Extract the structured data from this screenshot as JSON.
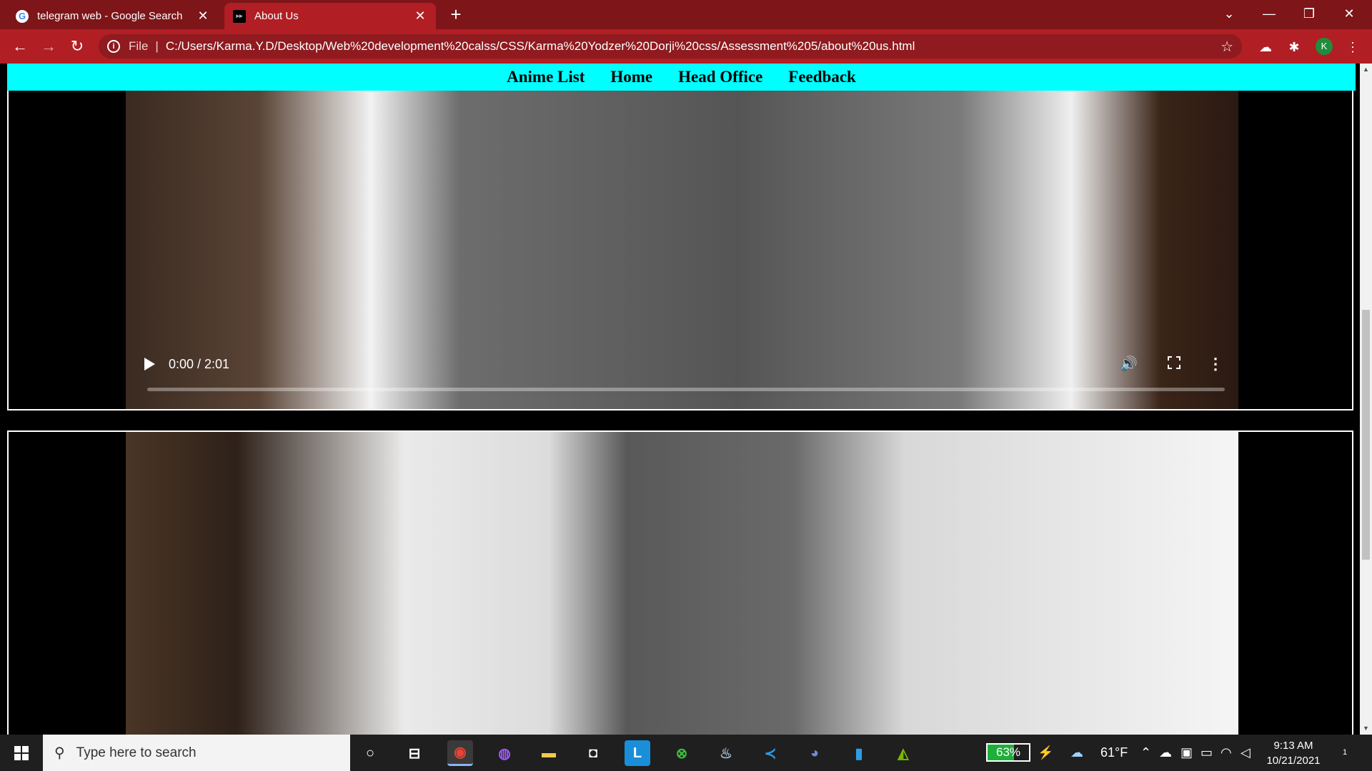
{
  "browser": {
    "tabs": [
      {
        "title": "telegram web - Google Search",
        "favicon": "G",
        "active": false
      },
      {
        "title": "About Us",
        "favicon": "▸▸",
        "active": true
      }
    ],
    "address": {
      "scheme_label": "File",
      "separator": "|",
      "url": "C:/Users/Karma.Y.D/Desktop/Web%20development%20calss/CSS/Karma%20Yodzer%20Dorji%20css/Assessment%205/about%20us.html"
    },
    "profile_initial": "K",
    "accent": "#b11e24",
    "tab_strip_color": "#7d1519"
  },
  "page": {
    "nav": [
      "Anime List",
      "Home",
      "Head Office",
      "Feedback"
    ],
    "nav_color": "#00ffff",
    "video": {
      "time": "0:00 / 2:01",
      "progress": 0
    }
  },
  "taskbar": {
    "search_placeholder": "Type here to search",
    "battery": "63%",
    "battery_level": 0.63,
    "weather": "61°F",
    "time": "9:13 AM",
    "date": "10/21/2021",
    "notification_count": "1"
  }
}
